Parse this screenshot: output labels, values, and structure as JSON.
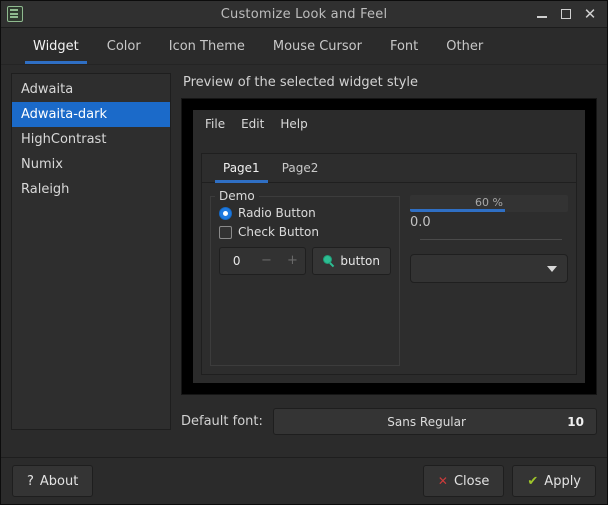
{
  "window": {
    "title": "Customize Look and Feel",
    "icon": "app-icon",
    "controls": {
      "minimize": "minimize-icon",
      "maximize": "maximize-icon",
      "close": "close-icon"
    }
  },
  "tabs": [
    {
      "label": "Widget",
      "active": true
    },
    {
      "label": "Color",
      "active": false
    },
    {
      "label": "Icon Theme",
      "active": false
    },
    {
      "label": "Mouse Cursor",
      "active": false
    },
    {
      "label": "Font",
      "active": false
    },
    {
      "label": "Other",
      "active": false
    }
  ],
  "theme_list": [
    {
      "label": "Adwaita",
      "selected": false
    },
    {
      "label": "Adwaita-dark",
      "selected": true
    },
    {
      "label": "HighContrast",
      "selected": false
    },
    {
      "label": "Numix",
      "selected": false
    },
    {
      "label": "Raleigh",
      "selected": false
    }
  ],
  "preview": {
    "label": "Preview of the selected widget style",
    "menubar": [
      "File",
      "Edit",
      "Help"
    ],
    "tabs": [
      {
        "label": "Page1",
        "active": true
      },
      {
        "label": "Page2",
        "active": false
      }
    ],
    "group_title": "Demo",
    "radio_label": "Radio Button",
    "check_label": "Check Button",
    "spinner_value": "0",
    "spinner_minus": "−",
    "spinner_plus": "+",
    "demo_button_label": "button",
    "progress_text": "60 %",
    "progress_percent": 60,
    "scale_value": "0.0",
    "combo_value": ""
  },
  "font_row": {
    "label": "Default font:",
    "name": "Sans Regular",
    "size": "10"
  },
  "footer": {
    "about": "About",
    "about_glyph": "?",
    "close": "Close",
    "close_glyph": "✕",
    "apply": "Apply",
    "apply_glyph": "✔"
  },
  "colors": {
    "accent_blue": "#2f6fc4",
    "selection_blue": "#1b6ac9",
    "close_red": "#cc3b3b",
    "apply_green": "#9fc62a",
    "icon_teal": "#2dbd92"
  }
}
